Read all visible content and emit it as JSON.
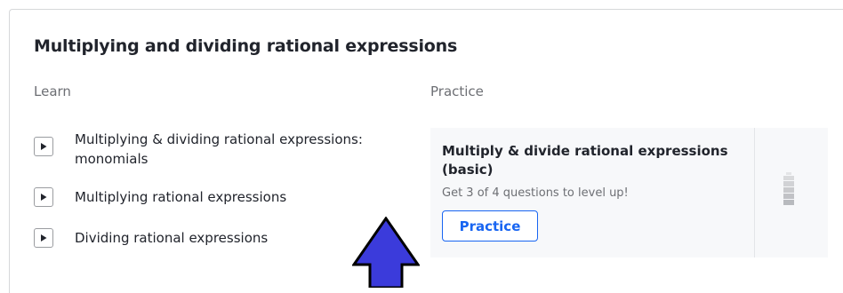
{
  "unit": {
    "title": "Multiplying and dividing rational expressions"
  },
  "learn": {
    "heading": "Learn",
    "items": [
      {
        "label": "Multiplying & dividing rational expressions: monomials",
        "icon": "play-icon"
      },
      {
        "label": "Multiplying rational expressions",
        "icon": "play-icon"
      },
      {
        "label": "Dividing rational expressions",
        "icon": "play-icon"
      }
    ]
  },
  "practice": {
    "heading": "Practice",
    "card": {
      "title": "Multiply & divide rational expressions (basic)",
      "subtitle": "Get 3 of 4 questions to level up!",
      "button_label": "Practice",
      "mastery_icon": "mastery-level-icon"
    }
  },
  "colors": {
    "accent": "#1865f2",
    "text": "#21242c",
    "muted": "#6d6f74",
    "card_bg": "#f7f8fa",
    "pointer_arrow": "#3b3bdb"
  }
}
